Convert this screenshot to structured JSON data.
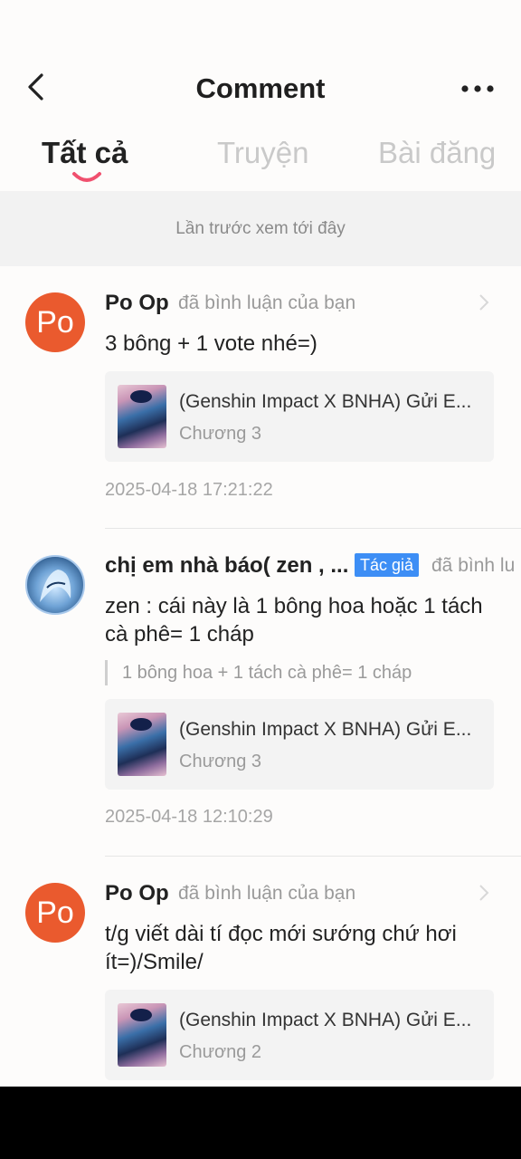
{
  "header": {
    "title": "Comment",
    "tabs": [
      {
        "label": "Tất cả",
        "active": true
      },
      {
        "label": "Truyện",
        "active": false
      },
      {
        "label": "Bài đăng",
        "active": false
      }
    ]
  },
  "banner": {
    "text": "Lần trước xem tới đây"
  },
  "comments": [
    {
      "user": "Po Op",
      "avatar_text": "Po",
      "action": "đã bình luận của bạn",
      "text": "3 bông + 1 vote nhé=)",
      "story_title": "(Genshin Impact X BNHA) Gửi E...",
      "chapter": "Chương 3",
      "time": "2025-04-18 17:21:22"
    },
    {
      "user": "chị em nhà báo( zen , ...",
      "tag": "Tác giả",
      "action": "đã bình lu",
      "text": "zen : cái này là 1 bông hoa hoặc 1 tách cà phê= 1 cháp",
      "quote": "1 bông hoa + 1 tách cà phê= 1 cháp",
      "story_title": "(Genshin Impact X BNHA) Gửi E...",
      "chapter": "Chương 3",
      "time": "2025-04-18 12:10:29"
    },
    {
      "user": "Po Op",
      "avatar_text": "Po",
      "action": "đã bình luận của bạn",
      "text": "t/g viết dài tí đọc mới sướng chứ hơi ít=)/Smile/",
      "story_title": "(Genshin Impact X BNHA) Gửi E...",
      "chapter": "Chương 2"
    }
  ],
  "colors": {
    "avatar_orange": "#ea5a2e",
    "tag_blue": "#3d8ef5",
    "tab_indicator": "#f0506e"
  },
  "icons": {
    "back": "chevron-left-icon",
    "more": "more-dots-icon",
    "chevron": "chevron-right-icon"
  }
}
